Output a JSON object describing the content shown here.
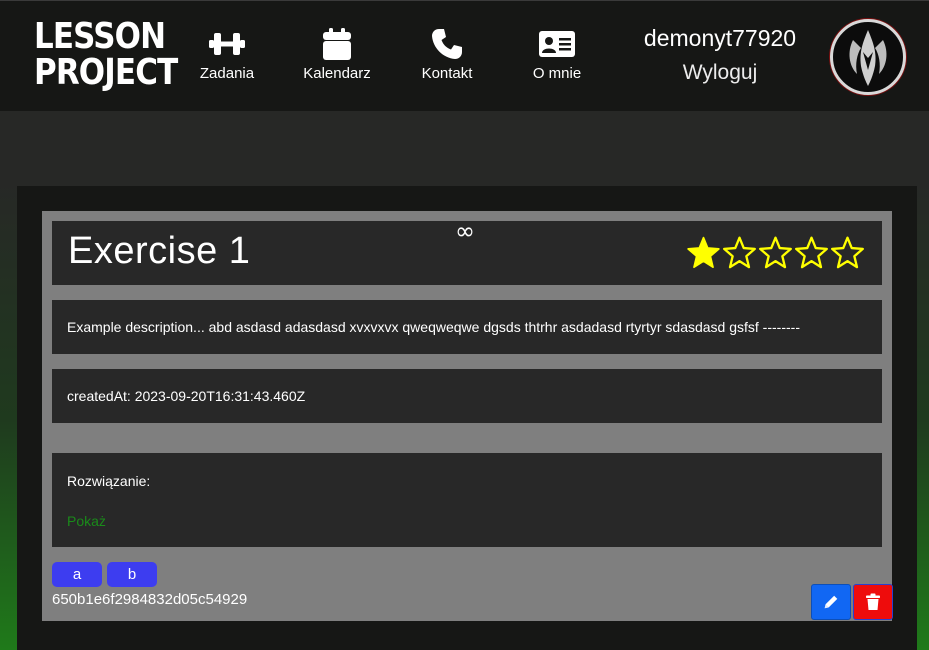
{
  "header": {
    "logo_line1": "LESSON",
    "logo_line2": "PROJECT",
    "nav": [
      {
        "label": "Zadania",
        "icon": "dumbbell-icon"
      },
      {
        "label": "Kalendarz",
        "icon": "calendar-icon"
      },
      {
        "label": "Kontakt",
        "icon": "phone-icon"
      },
      {
        "label": "O mnie",
        "icon": "id-card-icon"
      }
    ],
    "username": "demonyt77920",
    "logout_label": "Wyloguj"
  },
  "exercise": {
    "title": "Exercise 1",
    "infinity_symbol": "∞",
    "rating": 1,
    "rating_max": 5,
    "description": "Example description... abd asdasd adasdasd xvxvxvx qweqweqwe dgsds thtrhr asdadasd rtyrtyr sdasdasd gsfsf --------",
    "created_at": "createdAt: 2023-09-20T16:31:43.460Z",
    "solution_label": "Rozwiązanie:",
    "solution_show": "Pokaż",
    "tags": [
      "a",
      "b"
    ],
    "id": "650b1e6f2984832d05c54929"
  },
  "colors": {
    "star": "#ffff00",
    "tag_bg": "#3d3df0",
    "edit_bg": "#1167f3",
    "delete_bg": "#ee0c0c",
    "show_link": "#1a8a1a"
  },
  "actions": {
    "edit_icon": "pencil-icon",
    "delete_icon": "trash-icon"
  }
}
